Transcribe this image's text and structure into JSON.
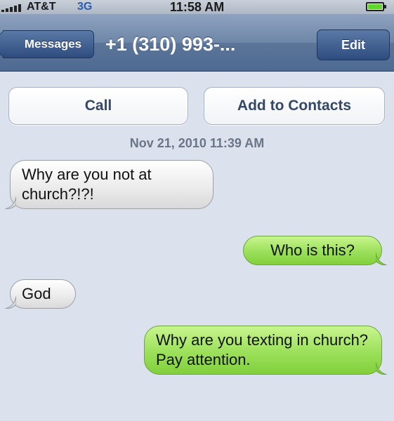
{
  "status_bar": {
    "carrier": "AT&T",
    "network": "3G",
    "time": "11:58 AM",
    "battery_icon": "battery-icon",
    "signal_icon": "signal-bars-icon"
  },
  "nav_bar": {
    "back_label": "Messages",
    "title": "+1 (310) 993-...",
    "edit_label": "Edit"
  },
  "actions": {
    "call_label": "Call",
    "add_contacts_label": "Add to Contacts"
  },
  "conversation": {
    "timestamp": "Nov 21, 2010 11:39 AM",
    "messages": [
      {
        "direction": "incoming",
        "text": "Why are you not at church?!?!"
      },
      {
        "direction": "outgoing",
        "text": "Who is this?"
      },
      {
        "direction": "incoming",
        "text": "God"
      },
      {
        "direction": "outgoing",
        "text": "Why are you texting in church? Pay attention."
      }
    ]
  },
  "colors": {
    "incoming_bubble": "#e9e9e9",
    "outgoing_bubble": "#9be05a",
    "background": "#dbe2ed",
    "nav_bar": "#6e86a8"
  }
}
